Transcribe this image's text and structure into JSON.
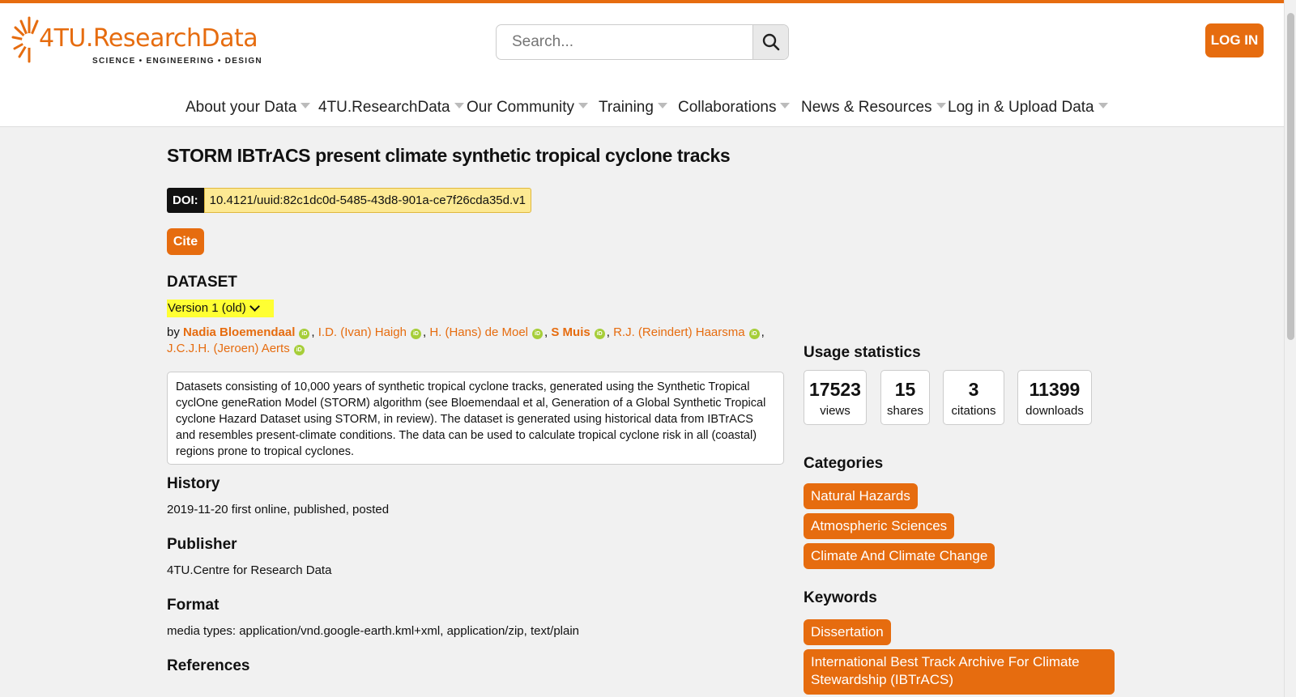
{
  "brand": {
    "logo_main": "4TU.ResearchData",
    "logo_sub": "SCIENCE • ENGINEERING • DESIGN",
    "accent_color": "#e66c0f"
  },
  "search": {
    "placeholder": "Search...",
    "icon": "search-icon"
  },
  "login_label": "LOG IN",
  "nav": [
    "About your Data",
    "4TU.ResearchData",
    "Our Community",
    "Training",
    "Collaborations",
    "News & Resources",
    "Log in & Upload Data"
  ],
  "dataset": {
    "title": "STORM IBTrACS present climate synthetic tropical cyclone tracks",
    "doi_label": "DOI:",
    "doi": "10.4121/uuid:82c1dc0d-5485-43d8-901a-ce7f26cda35d.v1",
    "cite_label": "Cite",
    "type_label": "DATASET",
    "version": "Version 1 (old)",
    "by": "by",
    "authors": [
      {
        "name": "Nadia Bloemendaal",
        "bold": true
      },
      {
        "name": "I.D. (Ivan) Haigh",
        "bold": false
      },
      {
        "name": "H. (Hans) de Moel",
        "bold": false
      },
      {
        "name": "S Muis",
        "bold": true
      },
      {
        "name": "R.J. (Reindert) Haarsma",
        "bold": false
      },
      {
        "name": "J.C.J.H. (Jeroen) Aerts",
        "bold": false
      }
    ],
    "orcid_mark": "iD",
    "description": "Datasets consisting of 10,000 years of synthetic tropical cyclone tracks, generated using the Synthetic Tropical cyclOne geneRation Model (STORM) algorithm (see Bloemendaal et al, Generation of a Global Synthetic Tropical cyclone Hazard Dataset using STORM, in review). The dataset is generated using historical data from IBTrACS and resembles present-climate conditions. The data can be used to calculate tropical cyclone risk in all (coastal) regions prone to tropical cyclones.",
    "history_label": "History",
    "history": "2019-11-20 first online, published, posted",
    "publisher_label": "Publisher",
    "publisher": "4TU.Centre for Research Data",
    "format_label": "Format",
    "format": "media types: application/vnd.google-earth.kml+xml, application/zip, text/plain",
    "references_label": "References"
  },
  "usage": {
    "title": "Usage statistics",
    "stats": [
      {
        "value": "17523",
        "label": "views"
      },
      {
        "value": "15",
        "label": "shares"
      },
      {
        "value": "3",
        "label": "citations"
      },
      {
        "value": "11399",
        "label": "downloads"
      }
    ]
  },
  "categories": {
    "title": "Categories",
    "items": [
      "Natural Hazards",
      "Atmospheric Sciences",
      "Climate And Climate Change"
    ]
  },
  "keywords": {
    "title": "Keywords",
    "items": [
      "Dissertation",
      "International Best Track Archive For Climate Stewardship (IBTrACS)"
    ]
  }
}
